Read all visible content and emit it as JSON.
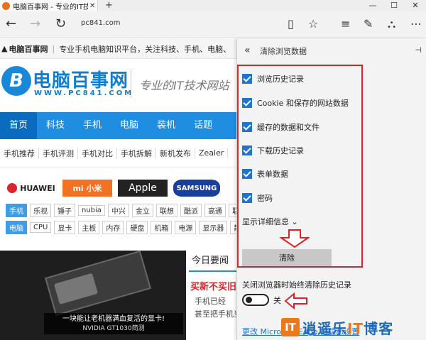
{
  "titlebar": {
    "tab_title": "电脑百事网 - 专业的IT技",
    "tab_close": "✕",
    "new_tab": "+",
    "minimize": "—",
    "maximize": "☐",
    "close": "✕"
  },
  "navbar": {
    "back": "←",
    "forward": "→",
    "refresh": "↻",
    "address": "pc841.com",
    "reading_view": "▯",
    "favorite": "☆",
    "hub": "≡",
    "web_note": "✎",
    "share": "⛬",
    "more": "⋯"
  },
  "webpage": {
    "topstrip": {
      "home_glyph": "▲",
      "site_short": "电脑百事网",
      "separator": "|",
      "intro": "专业手机电脑知识平台，关注科技、手机、电脑、"
    },
    "logo": {
      "mark": "B",
      "name": "电脑百事网",
      "url": "WWW.PC841.COM",
      "slogan": "专业的IT技术网站"
    },
    "main_nav": [
      "首页",
      "科技",
      "手机",
      "电脑",
      "装机",
      "话题"
    ],
    "sub_nav": [
      "手机推荐",
      "手机评测",
      "手机对比",
      "手机拆解",
      "新机发布",
      "Zealer"
    ],
    "brands": {
      "huawei": "HUAWEI",
      "mi": "mi 小米",
      "apple": " Apple",
      "samsung": "SAMSUNG"
    },
    "phone_tags": [
      "手机",
      "乐视",
      "锤子",
      "nubia",
      "中兴",
      "金立",
      "联想",
      "酷派",
      "高通",
      "联"
    ],
    "pc_tags": [
      "电脑",
      "CPU",
      "显卡",
      "主板",
      "内存",
      "硬盘",
      "机箱",
      "电源",
      "显示器",
      "散"
    ],
    "feature_caption": {
      "main": "一块能让老机器满血复活的显卡!",
      "sub": "NVIDIA GT1030简测"
    },
    "today": {
      "heading": "今日要闻",
      "headline": "买新不买旧",
      "line1": "手机已经",
      "line2": "甚至把手机当"
    }
  },
  "panel": {
    "back": "«",
    "title": "清除浏览数据",
    "pin": "⊣",
    "options": [
      {
        "label": "浏览历史记录",
        "checked": true
      },
      {
        "label": "Cookie 和保存的网站数据",
        "checked": true
      },
      {
        "label": "缓存的数据和文件",
        "checked": true
      },
      {
        "label": "下载历史记录",
        "checked": true
      },
      {
        "label": "表单数据",
        "checked": true
      },
      {
        "label": "密码",
        "checked": true
      }
    ],
    "details_link": "显示详细信息 ⌄",
    "clear_button": "清除",
    "always_clear_label": "关闭浏览器时始终清除历史记录",
    "toggle_state": "关",
    "toggle_on": false,
    "more_link": "更改 Microsoft Edge 的隐私设置",
    "annotation_color": "#d6252b",
    "accent_color": "#1f74d2"
  },
  "watermark": {
    "badge": "IT",
    "text_before": "逍遥乐",
    "text_accent": "IT",
    "text_after": "博客"
  }
}
